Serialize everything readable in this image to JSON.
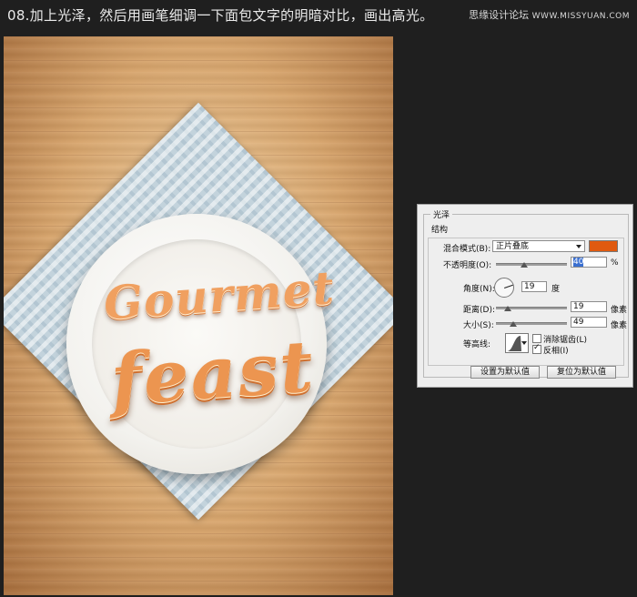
{
  "caption": "08.加上光泽，然后用画笔细调一下面包文字的明暗对比，画出高光。",
  "watermark": {
    "name": "思缘设计论坛",
    "url": "WWW.MISSYUAN.COM"
  },
  "artwork": {
    "line1": "Gourmet",
    "line2": "feast"
  },
  "dialog": {
    "title": "光泽",
    "structure_title": "结构",
    "blend_mode_label": "混合模式(B):",
    "blend_mode_value": "正片叠底",
    "blend_color": "#e05a10",
    "opacity_label": "不透明度(O):",
    "opacity_value": "40",
    "opacity_unit": "%",
    "angle_label": "角度(N):",
    "angle_value": "19",
    "angle_unit": "度",
    "distance_label": "距离(D):",
    "distance_value": "19",
    "distance_unit": "像素",
    "size_label": "大小(S):",
    "size_value": "49",
    "size_unit": "像素",
    "contour_label": "等高线:",
    "antialias_label": "消除锯齿(L)",
    "antialias_checked": false,
    "invert_label": "反相(I)",
    "invert_checked": true,
    "set_default_label": "设置为默认值",
    "reset_default_label": "复位为默认值"
  }
}
